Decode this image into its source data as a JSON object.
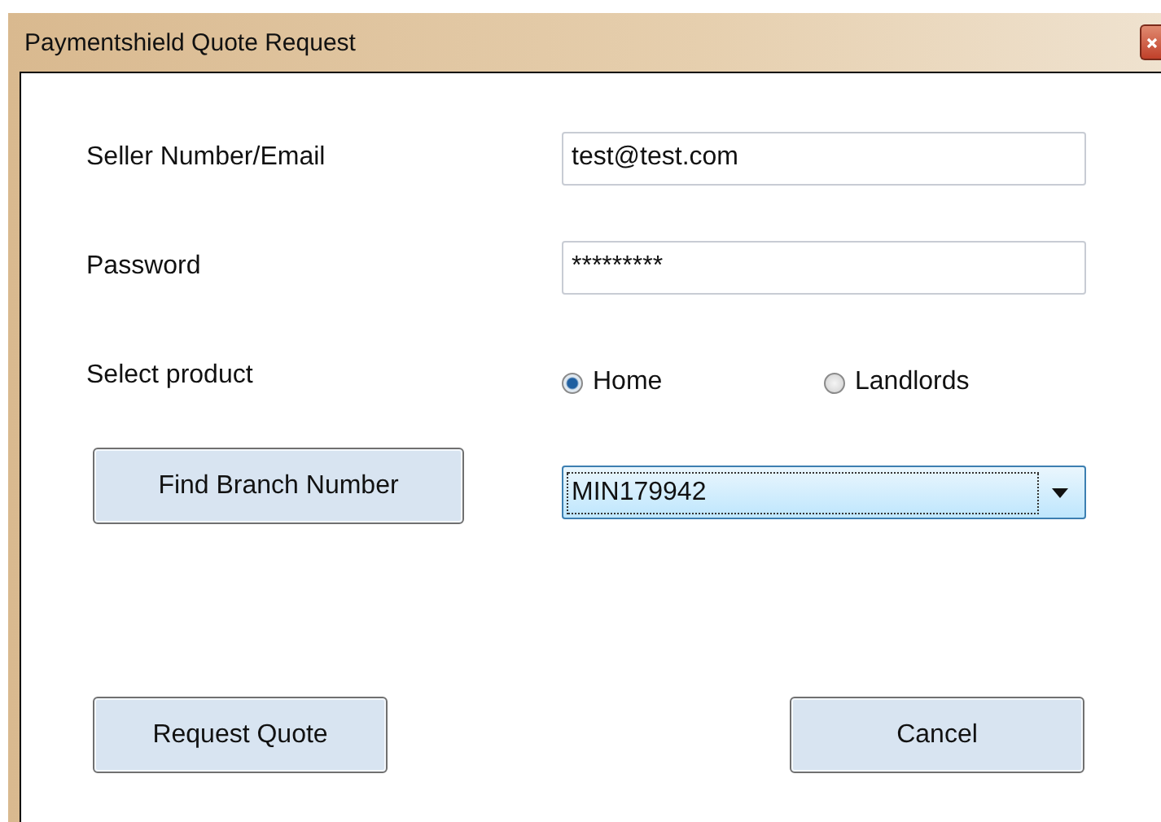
{
  "window": {
    "title": "Paymentshield Quote Request"
  },
  "fields": [
    {
      "label": "Seller Number/Email",
      "value": "test@test.com"
    },
    {
      "label": "Password",
      "value": "*********"
    }
  ],
  "product": {
    "label": "Select product",
    "options": [
      {
        "label": "Home",
        "selected": true
      },
      {
        "label": "Landlords",
        "selected": false
      }
    ]
  },
  "branch": {
    "button": "Find Branch Number",
    "value": "MIN179942"
  },
  "buttons": [
    "Request Quote",
    "Cancel"
  ]
}
